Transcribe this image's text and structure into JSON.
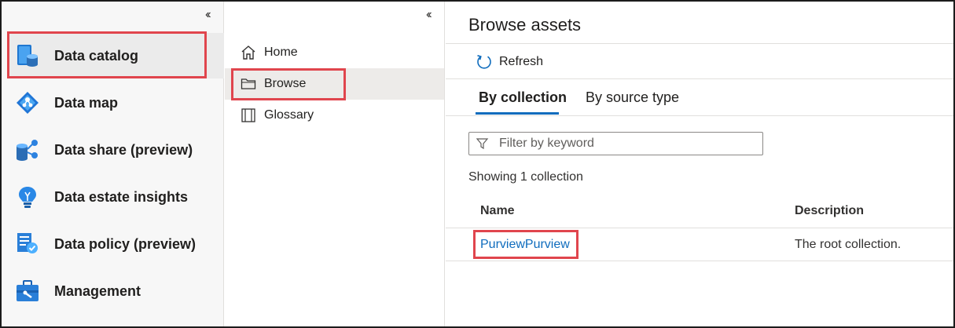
{
  "nav_primary": {
    "items": [
      {
        "label": "Data catalog",
        "icon": "data-catalog-icon"
      },
      {
        "label": "Data map",
        "icon": "data-map-icon"
      },
      {
        "label": "Data share (preview)",
        "icon": "data-share-icon"
      },
      {
        "label": "Data estate insights",
        "icon": "insights-lightbulb-icon"
      },
      {
        "label": "Data policy (preview)",
        "icon": "policy-document-icon"
      },
      {
        "label": "Management",
        "icon": "toolbox-icon"
      }
    ],
    "active_index": 0,
    "collapse_glyph": "‹‹"
  },
  "nav_secondary": {
    "items": [
      {
        "label": "Home",
        "icon": "home-icon"
      },
      {
        "label": "Browse",
        "icon": "folder-icon"
      },
      {
        "label": "Glossary",
        "icon": "book-icon"
      }
    ],
    "active_index": 1,
    "collapse_glyph": "‹‹"
  },
  "main": {
    "title": "Browse assets",
    "toolbar": {
      "refresh_label": "Refresh"
    },
    "tabs": [
      {
        "label": "By collection",
        "selected": true
      },
      {
        "label": "By source type",
        "selected": false
      }
    ],
    "filter": {
      "placeholder": "Filter by keyword",
      "value": ""
    },
    "showing_text": "Showing 1 collection",
    "table": {
      "columns": [
        "Name",
        "Description"
      ],
      "rows": [
        {
          "name": "PurviewPurview",
          "description": "The root collection."
        }
      ]
    }
  },
  "colors": {
    "accent": "#0f6cbd",
    "highlight": "#e0454d"
  }
}
